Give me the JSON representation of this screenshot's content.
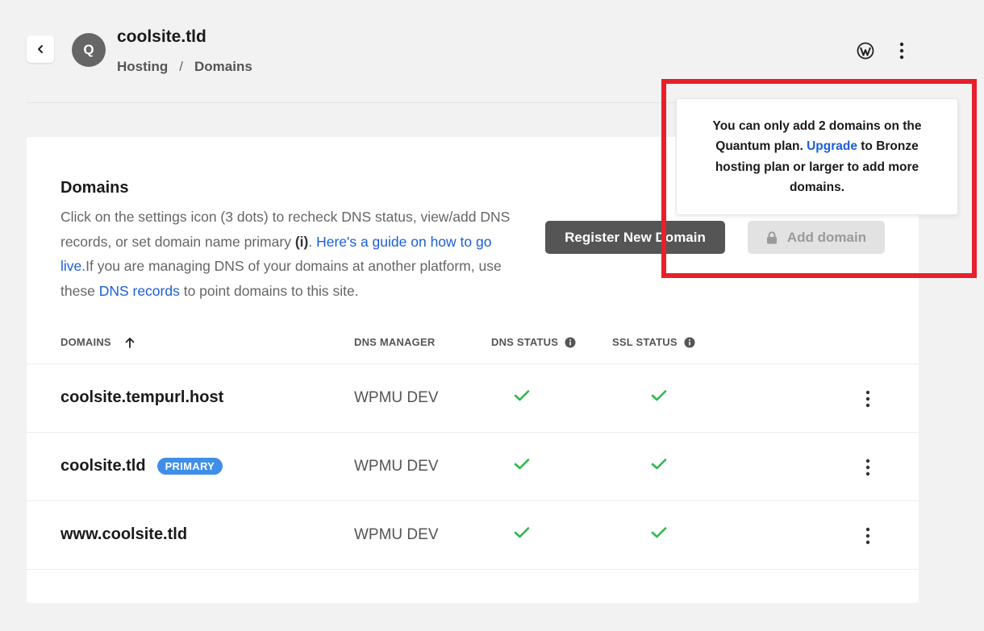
{
  "header": {
    "avatar_letter": "Q",
    "site_title": "coolsite.tld",
    "breadcrumb": [
      "Hosting",
      "Domains"
    ],
    "breadcrumb_sep": "/"
  },
  "card": {
    "title": "Domains",
    "desc_1": "Click on the settings icon (3 dots) to recheck DNS status, view/add DNS records, or set domain name primary ",
    "desc_info": "(i)",
    "desc_2": ". ",
    "guide_link": "Here's a guide on how to go live.",
    "desc_3": "If you are managing DNS of your domains at another platform, use these ",
    "dns_link": "DNS records",
    "desc_4": " to point domains to this site.",
    "register_label": "Register New Domain",
    "add_label": "Add domain"
  },
  "table": {
    "headers": {
      "domains": "DOMAINS",
      "dns_manager": "DNS MANAGER",
      "dns_status": "DNS STATUS",
      "ssl_status": "SSL STATUS"
    },
    "rows": [
      {
        "domain": "coolsite.tempurl.host",
        "badge": "",
        "manager": "WPMU DEV",
        "dns_ok": true,
        "ssl_ok": true
      },
      {
        "domain": "coolsite.tld",
        "badge": "PRIMARY",
        "manager": "WPMU DEV",
        "dns_ok": true,
        "ssl_ok": true
      },
      {
        "domain": "www.coolsite.tld",
        "badge": "",
        "manager": "WPMU DEV",
        "dns_ok": true,
        "ssl_ok": true
      }
    ]
  },
  "tooltip": {
    "text_1": "You can only add 2 domains on the Quantum plan. ",
    "link": "Upgrade",
    "text_2": " to Bronze hosting plan or larger to add more domains."
  },
  "colors": {
    "link": "#1a5fd8",
    "check": "#2fb84e",
    "badge": "#3f8ee8",
    "highlight": "#e8202a"
  }
}
